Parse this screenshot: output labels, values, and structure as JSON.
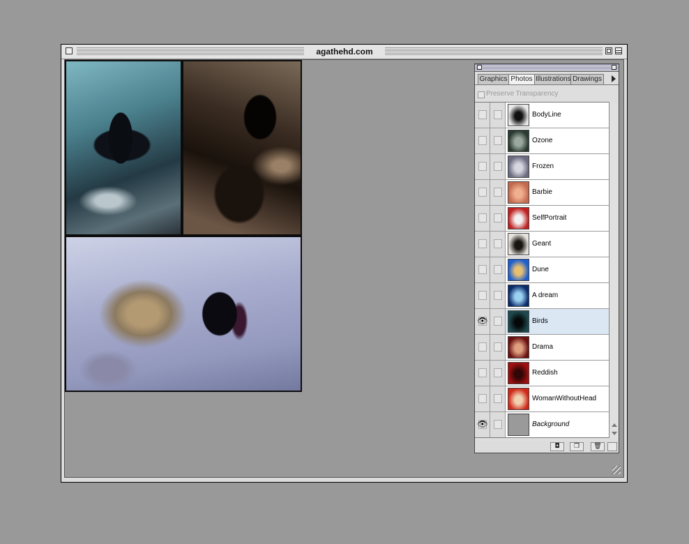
{
  "window": {
    "title": "agathehd.com"
  },
  "palette": {
    "tabs": [
      {
        "label": "Graphics",
        "active": false
      },
      {
        "label": "Photos",
        "active": true
      },
      {
        "label": "Illustrations",
        "active": false
      },
      {
        "label": "Drawings",
        "active": false
      }
    ],
    "preserve_transparency_label": "Preserve Transparency",
    "layers": [
      {
        "name": "BodyLine",
        "visible": false,
        "selected": false,
        "thumb_color": "#e8e8e8",
        "thumb_accent": "#111111"
      },
      {
        "name": "Ozone",
        "visible": false,
        "selected": false,
        "thumb_color": "#2a3a30",
        "thumb_accent": "#9aa8a0"
      },
      {
        "name": "Frozen",
        "visible": false,
        "selected": false,
        "thumb_color": "#6a6a80",
        "thumb_accent": "#d6d6e0"
      },
      {
        "name": "Barbie",
        "visible": false,
        "selected": false,
        "thumb_color": "#c46a4e",
        "thumb_accent": "#f0b090"
      },
      {
        "name": "SelfPortrait",
        "visible": false,
        "selected": false,
        "thumb_color": "#c02020",
        "thumb_accent": "#f4f0f0"
      },
      {
        "name": "Geant",
        "visible": false,
        "selected": false,
        "thumb_color": "#e6e2dc",
        "thumb_accent": "#181410"
      },
      {
        "name": "Dune",
        "visible": false,
        "selected": false,
        "thumb_color": "#1e5fd0",
        "thumb_accent": "#e8c070"
      },
      {
        "name": "A dream",
        "visible": false,
        "selected": false,
        "thumb_color": "#0a2a6a",
        "thumb_accent": "#9ad0f0"
      },
      {
        "name": "Birds",
        "visible": true,
        "selected": true,
        "thumb_color": "#1e4a4e",
        "thumb_accent": "#050808"
      },
      {
        "name": "Drama",
        "visible": false,
        "selected": false,
        "thumb_color": "#6a1010",
        "thumb_accent": "#e0a080"
      },
      {
        "name": "Reddish",
        "visible": false,
        "selected": false,
        "thumb_color": "#a01010",
        "thumb_accent": "#300606"
      },
      {
        "name": "WomanWithoutHead",
        "visible": false,
        "selected": false,
        "thumb_color": "#d02818",
        "thumb_accent": "#f0d0b0"
      },
      {
        "name": "Background",
        "visible": true,
        "selected": false,
        "italic": true,
        "thumb_color": "#9a9a9a",
        "thumb_accent": "#9a9a9a"
      }
    ],
    "bottom_buttons": [
      "mask-icon",
      "new-layer-icon",
      "trash-icon"
    ]
  },
  "icons": {
    "eye": "👁"
  }
}
